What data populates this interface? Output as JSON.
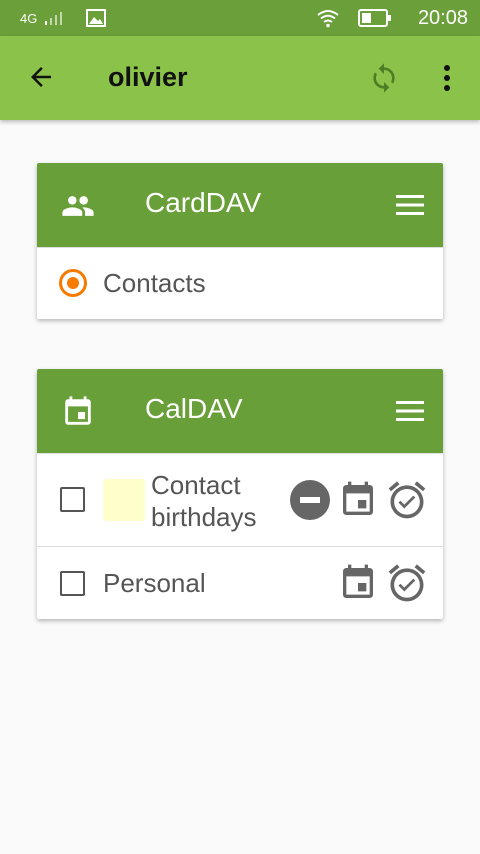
{
  "status_bar": {
    "network": "4G",
    "time": "20:08",
    "icons": [
      "signal-icon",
      "image-icon",
      "wifi-icon",
      "battery-icon"
    ]
  },
  "app_bar": {
    "title": "olivier",
    "icons": [
      "back-arrow-icon",
      "sync-icon",
      "more-vert-icon"
    ]
  },
  "carddav": {
    "title": "CardDAV",
    "icon": "people-icon",
    "items": [
      {
        "label": "Contacts",
        "selected": true
      }
    ]
  },
  "caldav": {
    "title": "CalDAV",
    "icon": "calendar-icon",
    "items": [
      {
        "label_line1": "Contact",
        "label_line2": "birthdays",
        "checked": false,
        "color": "#ffffcc",
        "read_only": true,
        "icons": [
          "read-only-icon",
          "calendar-icon",
          "alarm-check-icon"
        ]
      },
      {
        "label": "Personal",
        "checked": false,
        "icons": [
          "calendar-icon",
          "alarm-check-icon"
        ]
      }
    ]
  },
  "colors": {
    "status_bar": "#6a9f39",
    "app_bar": "#8bc34a",
    "card_header": "#689f38",
    "accent": "#f57c00"
  }
}
